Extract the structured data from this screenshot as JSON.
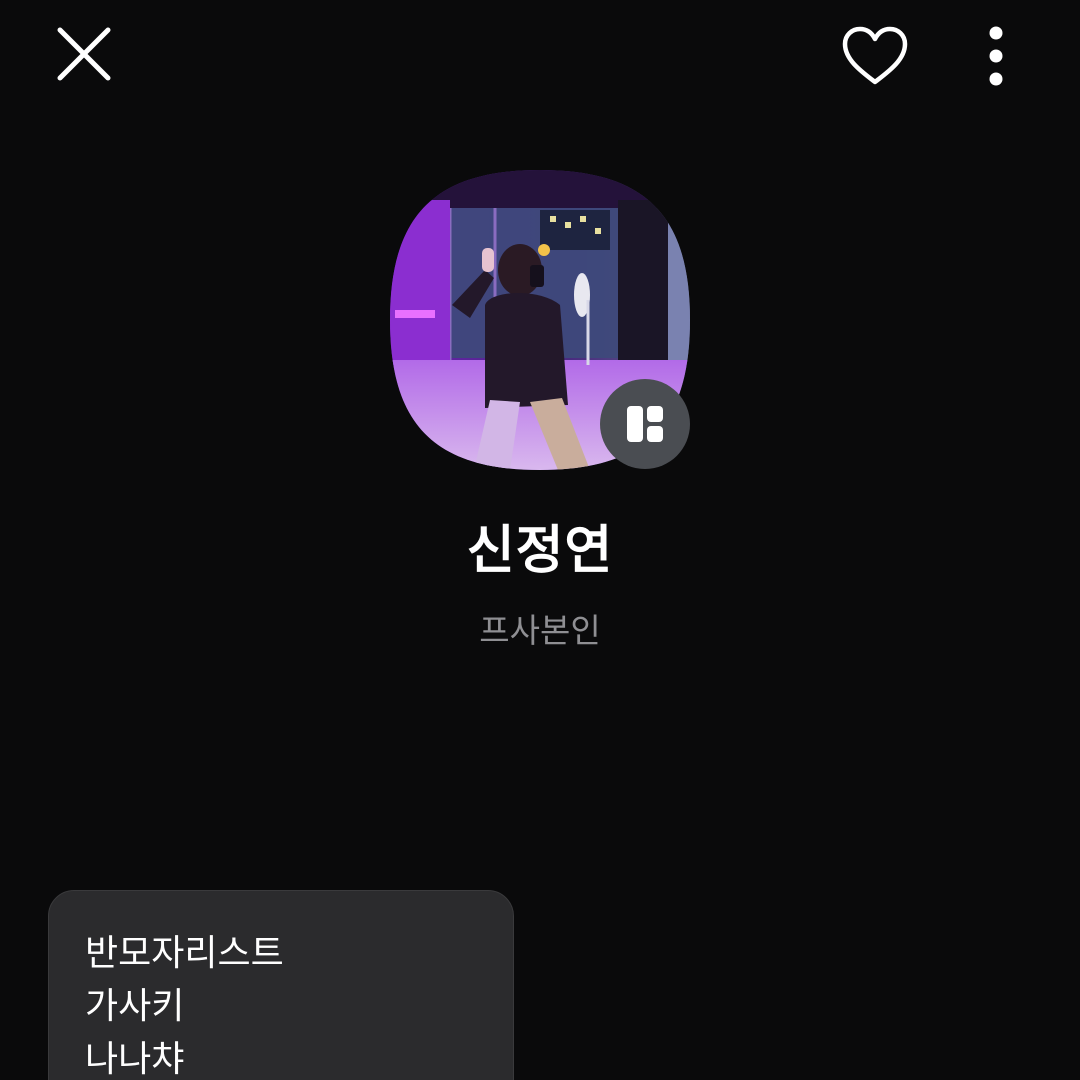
{
  "header": {
    "close_icon": "close-icon",
    "like_icon": "heart-outline-icon",
    "more_icon": "more-vertical-icon"
  },
  "profile": {
    "name": "신정연",
    "status_message": "프사본인",
    "avatar_badge_icon": "layout-grid-icon"
  },
  "memo": {
    "lines": [
      "반모자리스트",
      "가사키",
      "나나챠"
    ]
  },
  "colors": {
    "background": "#0a0a0b",
    "memo_background": "#2b2b2d",
    "status_text": "#8f8f93",
    "badge_background": "#4a4d52",
    "avatar_accent": "#a640e8"
  }
}
